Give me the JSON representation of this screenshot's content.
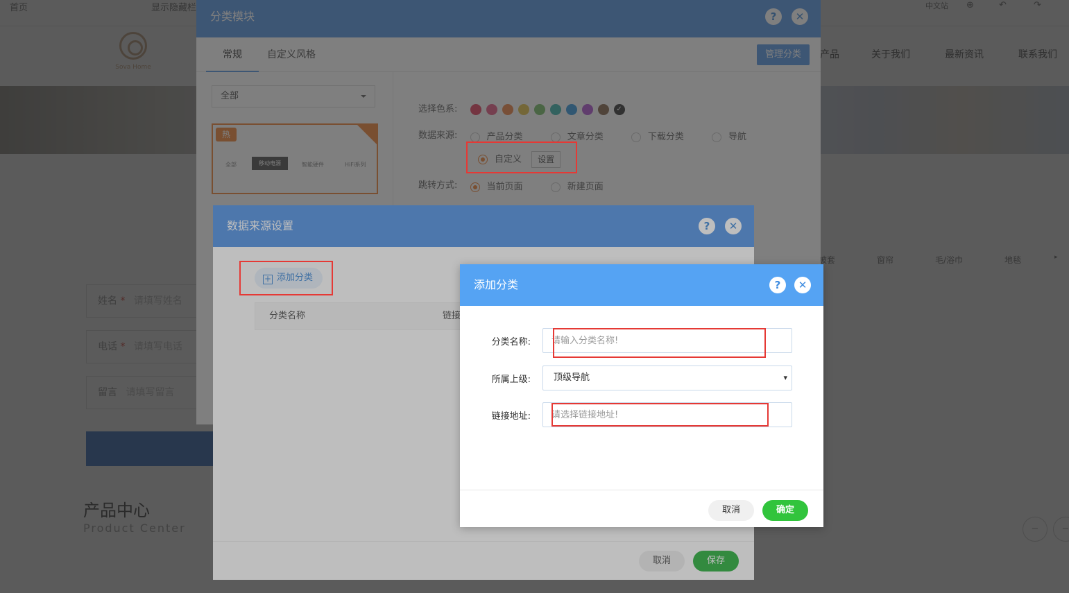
{
  "bg": {
    "topbar": {
      "home": "首页",
      "show_hidden": "显示隐藏栏",
      "lang": "中文站"
    },
    "logo_sub": "Sova Home",
    "nav": [
      "产品",
      "关于我们",
      "最新资讯",
      "联系我们"
    ],
    "categories": [
      "被套",
      "窗帘",
      "毛/浴巾",
      "地毯"
    ],
    "form": {
      "name_label": "姓名",
      "name_req": "*",
      "name_ph": "请填写姓名",
      "phone_label": "电话",
      "phone_req": "*",
      "phone_ph": "请填写电话",
      "msg_label": "留言",
      "msg_ph": "请填写留言"
    },
    "product_title": "产品中心",
    "product_sub": "Product Center",
    "circle_btns": [
      "−",
      "−"
    ]
  },
  "d1": {
    "title": "分类模块",
    "help": "?",
    "close": "✕",
    "tabs": [
      "常规",
      "自定义风格"
    ],
    "manage_btn": "管理分类",
    "select_value": "全部",
    "thumb": {
      "hot": "热",
      "labels": [
        "全部",
        "移动电源",
        "智能硬件",
        "HiFi系列"
      ]
    },
    "color_label": "选择色系:",
    "colors": [
      "#e44b67",
      "#e7638b",
      "#ee8b4f",
      "#e6c451",
      "#7cc06e",
      "#46b9b0",
      "#3e9de0",
      "#b45ed5",
      "#8c6e56",
      "#3f3f3f"
    ],
    "source_label": "数据来源:",
    "sources": [
      "产品分类",
      "文章分类",
      "下载分类",
      "导航"
    ],
    "custom_label": "自定义",
    "set_btn": "设置",
    "jump_label": "跳转方式:",
    "jump_opts": [
      "当前页面",
      "新建页面"
    ]
  },
  "d2": {
    "title": "数据来源设置",
    "help": "?",
    "close": "✕",
    "add_btn": "添加分类",
    "col_name": "分类名称",
    "col_link": "链接",
    "cancel": "取消",
    "save": "保存"
  },
  "d3": {
    "title": "添加分类",
    "help": "?",
    "close": "✕",
    "name_label": "分类名称:",
    "name_placeholder": "请输入分类名称!",
    "parent_label": "所属上级:",
    "parent_value": "顶级导航",
    "link_label": "链接地址:",
    "link_placeholder": "请选择链接地址!",
    "cancel": "取消",
    "ok": "确定"
  }
}
